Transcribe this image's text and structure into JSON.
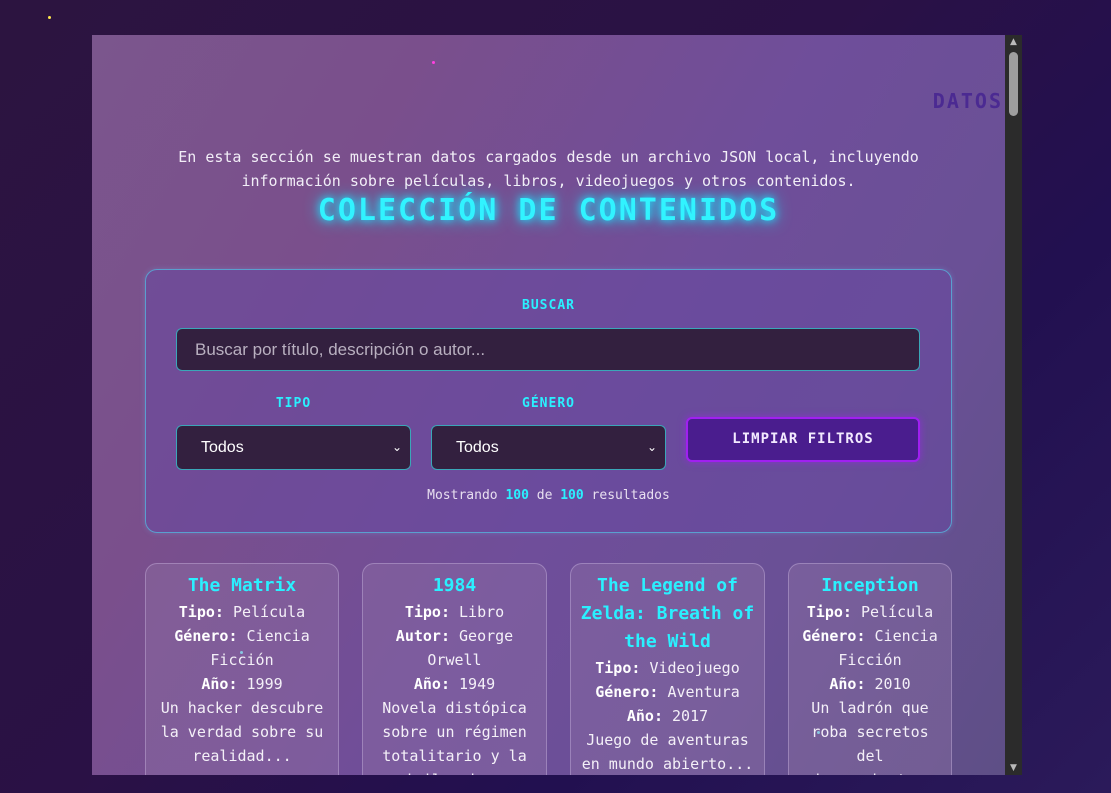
{
  "nav": {
    "label": "DATOS"
  },
  "intro": {
    "text": "En esta sección se muestran datos cargados desde un archivo JSON local, incluyendo información sobre películas, libros, videojuegos y otros contenidos."
  },
  "title": "COLECCIÓN DE CONTENIDOS",
  "filters": {
    "search_label": "BUSCAR",
    "search_placeholder": "Buscar por título, descripción o autor...",
    "type_label": "TIPO",
    "type_value": "Todos",
    "genre_label": "GÉNERO",
    "genre_value": "Todos",
    "clear_button": "LIMPIAR FILTROS",
    "results_prefix": "Mostrando",
    "results_shown": "100",
    "results_mid": "de",
    "results_total": "100",
    "results_suffix": "resultados"
  },
  "cards": [
    {
      "title": "The Matrix",
      "field1_label": "Tipo:",
      "field1_value": "Película",
      "field2_label": "Género:",
      "field2_value": "Ciencia Ficción",
      "year_label": "Año:",
      "year_value": "1999",
      "description": "Un hacker descubre la verdad sobre su realidad..."
    },
    {
      "title": "1984",
      "field1_label": "Tipo:",
      "field1_value": "Libro",
      "field2_label": "Autor:",
      "field2_value": "George Orwell",
      "year_label": "Año:",
      "year_value": "1949",
      "description": "Novela distópica sobre un régimen totalitario y la vigilancia..."
    },
    {
      "title": "The Legend of Zelda: Breath of the Wild",
      "field1_label": "Tipo:",
      "field1_value": "Videojuego",
      "field2_label": "Género:",
      "field2_value": "Aventura",
      "year_label": "Año:",
      "year_value": "2017",
      "description": "Juego de aventuras en mundo abierto..."
    },
    {
      "title": "Inception",
      "field1_label": "Tipo:",
      "field1_value": "Película",
      "field2_label": "Género:",
      "field2_value": "Ciencia Ficción",
      "year_label": "Año:",
      "year_value": "2010",
      "description": "Un ladrón que roba secretos del subconsciente..."
    }
  ],
  "scroll": {
    "up_icon": "triangle-up",
    "down_icon": "triangle-down"
  },
  "colors": {
    "accent": "#2af0ff",
    "button_border": "#a020f0",
    "nav": "#4b2a92"
  }
}
